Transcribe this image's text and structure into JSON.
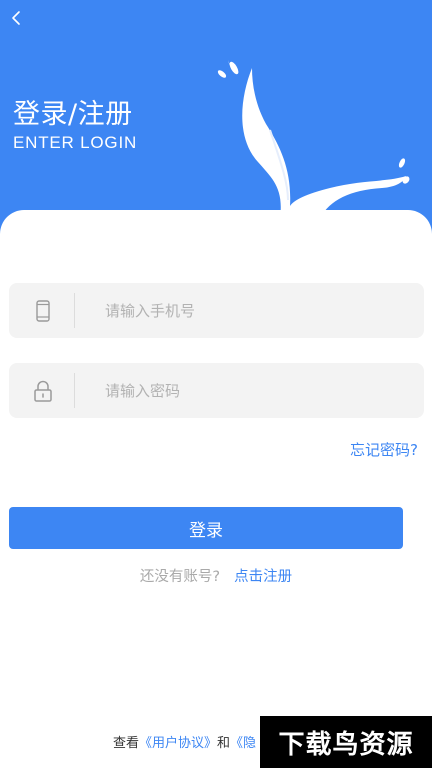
{
  "header": {
    "title": "登录/注册",
    "subtitle": "ENTER LOGIN",
    "background_color": "#3d86f3",
    "back_icon": "chevron-left-icon",
    "decoration_icon": "whale-tail-icon"
  },
  "form": {
    "phone": {
      "icon": "phone-icon",
      "placeholder": "请输入手机号",
      "value": ""
    },
    "password": {
      "icon": "lock-icon",
      "placeholder": "请输入密码",
      "value": ""
    },
    "forgot_label": "忘记密码?",
    "login_label": "登录"
  },
  "register": {
    "prompt": "还没有账号?",
    "link_label": "点击注册"
  },
  "agreement": {
    "prefix": "查看",
    "user_agreement": "《用户协议》",
    "conjunction": "和",
    "privacy_partial": "《隐"
  },
  "watermark": {
    "text": "下载鸟资源"
  },
  "colors": {
    "accent": "#3d86f3",
    "field_bg": "#f3f3f3",
    "muted_text": "#a9a9a9"
  }
}
